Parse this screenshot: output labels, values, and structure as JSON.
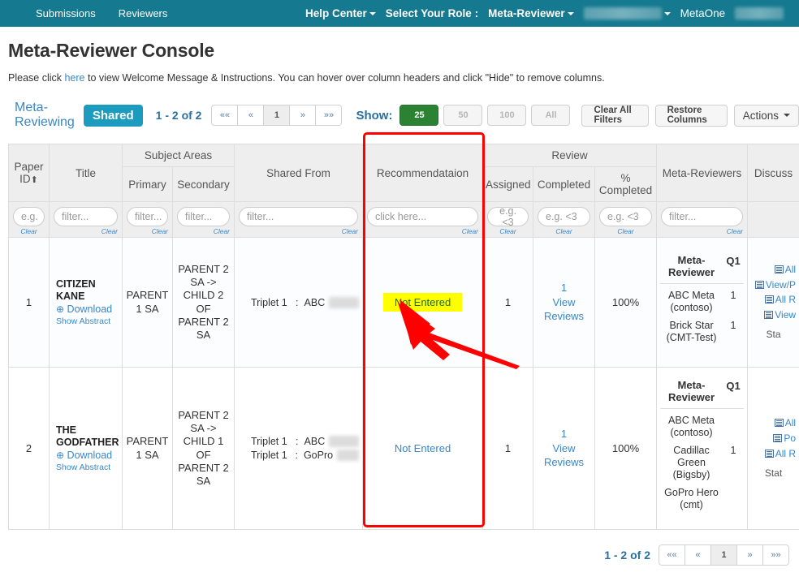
{
  "navbar": {
    "left_links": [
      "Submissions",
      "Reviewers"
    ],
    "help_center": "Help Center",
    "select_role_label": "Select Your Role :",
    "role": "Meta-Reviewer",
    "conference": "MetaOne"
  },
  "page": {
    "title": "Meta-Reviewer Console",
    "instructions_before": "Please click ",
    "instructions_link": "here",
    "instructions_after": " to view Welcome Message & Instructions. You can hover over column headers and click \"Hide\" to remove columns."
  },
  "toolbar": {
    "tab_meta_reviewing": "Meta-Reviewing",
    "tab_shared": "Shared",
    "range_label": "1 - 2 of 2",
    "pager": [
      "««",
      "«",
      "1",
      "»",
      "»»"
    ],
    "current_page": "1",
    "show_label": "Show:",
    "show_options": [
      "25",
      "50",
      "100",
      "All"
    ],
    "show_selected": "25",
    "clear_all_filters": "Clear All Filters",
    "restore_columns": "Restore Columns",
    "actions": "Actions"
  },
  "table": {
    "group_headers": {
      "subject_areas": "Subject Areas",
      "review": "Review"
    },
    "headers": {
      "paper_id": "Paper ID",
      "sort_arrow": "⬆",
      "title": "Title",
      "primary": "Primary",
      "secondary": "Secondary",
      "shared_from": "Shared From",
      "recommendation": "Recommendataion",
      "assigned": "Assigned",
      "completed": "Completed",
      "pct_completed": "% Completed",
      "meta_reviewers": "Meta-Reviewers",
      "discuss": "Discuss"
    },
    "filters": {
      "paper_id": "e.g.",
      "title": "filter...",
      "primary": "filter...",
      "secondary": "filter...",
      "shared_from": "filter...",
      "recommendation": "click here...",
      "assigned": "e.g. <3",
      "completed": "e.g. <3",
      "pct_completed": "e.g. <3",
      "meta_reviewers": "filter...",
      "clear": "Clear"
    },
    "mr_subheaders": {
      "name": "Meta-Reviewer",
      "q1": "Q1"
    },
    "links": {
      "download": "Download",
      "show_abstract": "Show Abstract",
      "view_reviews": "View Reviews"
    },
    "rows": [
      {
        "paper_id": "1",
        "title": "CITIZEN KANE",
        "primary": "PARENT 1 SA",
        "secondary": "PARENT 2 SA -> CHILD 2 OF PARENT 2 SA",
        "shared_from": [
          {
            "triplet": "Triplet 1",
            "sep": ":",
            "name": "ABC"
          }
        ],
        "recommendation": "Not Entered",
        "recommendation_highlighted": true,
        "assigned": "1",
        "completed": "1",
        "pct_completed": "100%",
        "meta_reviewers": [
          {
            "name": "ABC Meta (contoso)",
            "q1": "1"
          },
          {
            "name": "Brick Star (CMT-Test)",
            "q1": "1"
          }
        ],
        "discuss_links": [
          "All",
          "View/P",
          "All R",
          "View"
        ],
        "discuss_status": "Sta"
      },
      {
        "paper_id": "2",
        "title": "THE GODFATHER",
        "primary": "PARENT 1 SA",
        "secondary": "PARENT 2 SA -> CHILD 1 OF PARENT 2 SA",
        "shared_from": [
          {
            "triplet": "Triplet 1",
            "sep": ":",
            "name": "ABC"
          },
          {
            "triplet": "Triplet 1",
            "sep": ":",
            "name": "GoPro"
          }
        ],
        "recommendation": "Not Entered",
        "recommendation_highlighted": false,
        "assigned": "1",
        "completed": "1",
        "pct_completed": "100%",
        "meta_reviewers": [
          {
            "name": "ABC Meta (contoso)",
            "q1": ""
          },
          {
            "name": "Cadillac Green (Bigsby)",
            "q1": "1"
          },
          {
            "name": "GoPro Hero (cmt)",
            "q1": ""
          }
        ],
        "discuss_links": [
          "All",
          "Po",
          "All R"
        ],
        "discuss_status": "Stat"
      }
    ]
  },
  "bottom": {
    "range_label": "1 - 2 of 2",
    "pager": [
      "««",
      "«",
      "1",
      "»",
      "»»"
    ],
    "current_page": "1"
  },
  "colors": {
    "navbar": "#15798f",
    "accent_link": "#3a87c8",
    "tab_active": "#1b9bbd",
    "show_selected": "#2c8233",
    "highlight": "#ffff00",
    "callout": "#ff0000"
  }
}
